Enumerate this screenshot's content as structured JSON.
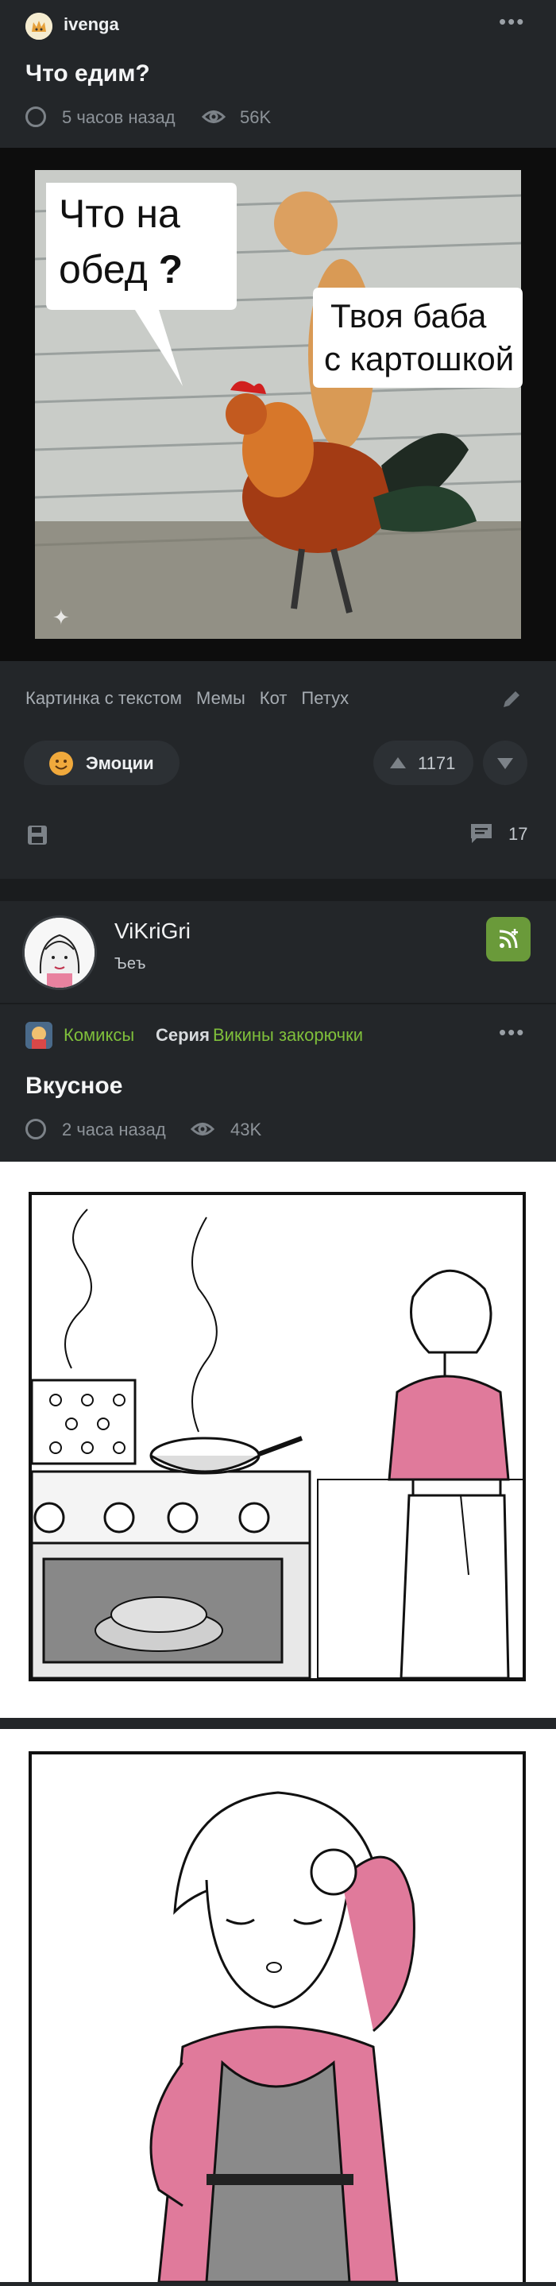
{
  "post1": {
    "author": "ivenga",
    "title": "Что едим?",
    "time": "5 часов назад",
    "views": "56K",
    "image_text_left": "Что на обед ?",
    "image_text_right": "Твоя баба с картошкой",
    "tags": [
      "Картинка с текстом",
      "Мемы",
      "Кот",
      "Петух"
    ],
    "reaction_label": "Эмоции",
    "rating": "1171",
    "comments": "17",
    "icons": [
      "clock-icon",
      "eye-icon",
      "pencil-icon",
      "arrow-up-icon",
      "arrow-down-icon",
      "save-icon",
      "comment-icon",
      "more-icon"
    ]
  },
  "post2": {
    "author": "ViKriGri",
    "subtitle": "Ъеъ",
    "community": "Комиксы",
    "series_label": "Серия",
    "series_name": "Викины закорючки",
    "title": "Вкусное",
    "time": "2 часа назад",
    "views": "43K",
    "accent": "#6a9a3a"
  },
  "colors": {
    "background": "#232629",
    "accent_green": "#7fbf3b"
  }
}
